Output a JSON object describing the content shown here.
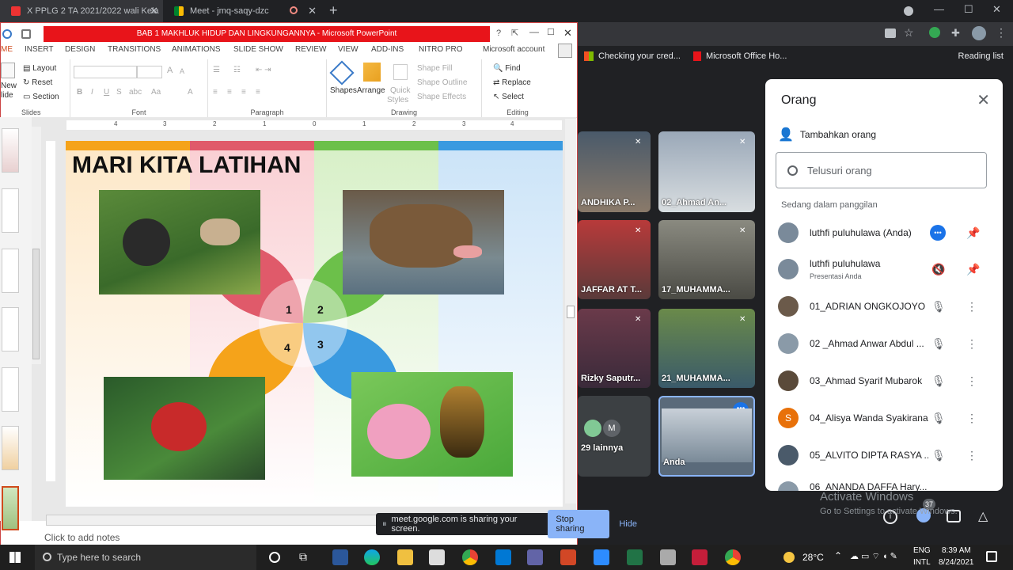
{
  "browser": {
    "tabs": [
      {
        "title": "X PPLG 2 TA 2021/2022 wali Kela",
        "close": "✕"
      },
      {
        "title": "Meet - jmq-saqy-dzc",
        "close": "✕"
      }
    ],
    "new_tab": "+",
    "bookmarks": [
      "Checking your cred...",
      "Microsoft Office Ho..."
    ],
    "reading_list": "Reading list"
  },
  "powerpoint": {
    "title": "BAB 1 MAKHLUK HIDUP DAN LINGKUNGANNYA - Microsoft PowerPoint",
    "account": "Microsoft account",
    "ribbon_tabs": [
      "ME",
      "INSERT",
      "DESIGN",
      "TRANSITIONS",
      "ANIMATIONS",
      "SLIDE SHOW",
      "REVIEW",
      "VIEW",
      "ADD-INS",
      "NITRO PRO"
    ],
    "slides_group": {
      "new": "New",
      "slide": "lide",
      "layout": "Layout",
      "reset": "Reset",
      "section": "Section",
      "label": "Slides"
    },
    "font_label": "Font",
    "paragraph_label": "Paragraph",
    "drawing": {
      "shapes": "Shapes",
      "arrange": "Arrange",
      "quick": "Quick",
      "styles": "Styles",
      "fill": "Shape Fill",
      "outline": "Shape Outline",
      "effects": "Shape Effects",
      "label": "Drawing"
    },
    "editing": {
      "find": "Find",
      "replace": "Replace",
      "select": "Select",
      "label": "Editing"
    },
    "ruler_marks": [
      "4",
      "3",
      "2",
      "1",
      "0",
      "1",
      "2",
      "3",
      "4"
    ],
    "slide": {
      "heading": "MARI KITA LATIHAN",
      "numbers": [
        "1",
        "2",
        "4",
        "3"
      ]
    },
    "notes": "Click to add notes"
  },
  "meet": {
    "tiles": [
      {
        "name": "ANDHIKA P..."
      },
      {
        "name": "02_Ahmad An..."
      },
      {
        "name": "JAFFAR AT T..."
      },
      {
        "name": "17_MUHAMMA..."
      },
      {
        "name": "Rizky Saputr..."
      },
      {
        "name": "21_MUHAMMA..."
      },
      {
        "name": "29 lainnya",
        "initial": "M"
      },
      {
        "name": "Anda"
      }
    ],
    "sharing": {
      "text": "meet.google.com is sharing your screen.",
      "stop": "Stop sharing",
      "hide": "Hide"
    },
    "badge": "37",
    "activate_title": "Activate Windows",
    "activate_sub": "Go to Settings to activate Windows."
  },
  "people_panel": {
    "title": "Orang",
    "add": "Tambahkan orang",
    "search_placeholder": "Telusuri orang",
    "section": "Sedang dalam panggilan",
    "people": [
      {
        "name": "luthfi puluhulawa (Anda)",
        "color": "#7a8a9a"
      },
      {
        "name": "luthfi puluhulawa",
        "sub": "Presentasi Anda",
        "color": "#7a8a9a"
      },
      {
        "name": "01_ADRIAN ONGKOJOYO",
        "color": "#6b5a4a"
      },
      {
        "name": "02 _Ahmad Anwar Abdul ...",
        "color": "#8a9aa8"
      },
      {
        "name": "03_Ahmad Syarif Mubarok",
        "color": "#5a4a3a"
      },
      {
        "name": "04_Alisya Wanda Syakirana",
        "initial": "S",
        "color": "#e8710a"
      },
      {
        "name": "05_ALVITO DIPTA RASYA ...",
        "color": "#4a5a6a"
      },
      {
        "name": "06_ANANDA DAFFA Hary...",
        "color": "#8a9aa8"
      }
    ]
  },
  "taskbar": {
    "search": "Type here to search",
    "weather": "28°C",
    "lang1": "ENG",
    "lang2": "INTL",
    "time": "8:39 AM",
    "date": "8/24/2021"
  }
}
